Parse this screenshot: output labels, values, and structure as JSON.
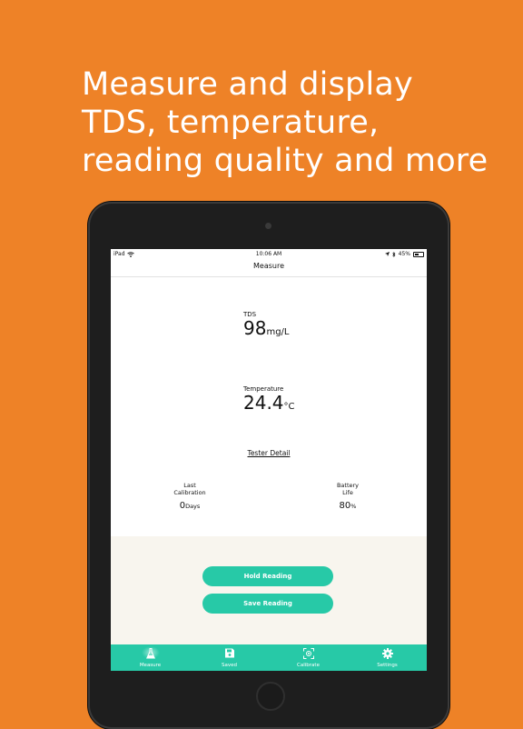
{
  "headline": {
    "lines": [
      "Measure and display",
      "TDS, temperature,",
      "reading quality and more"
    ]
  },
  "status_bar": {
    "device": "iPad",
    "time": "10:06 AM",
    "battery": "45%"
  },
  "nav": {
    "title": "Measure"
  },
  "tds": {
    "label": "TDS",
    "value": "98",
    "unit": "mg/L"
  },
  "temperature": {
    "label": "Temperature",
    "value": "24.4",
    "unit": "°C"
  },
  "tester_detail": "Tester Detail",
  "last_calibration": {
    "label_line1": "Last",
    "label_line2": "Calibration",
    "value": "0",
    "unit": "Days"
  },
  "battery_life": {
    "label_line1": "Battery",
    "label_line2": "Life",
    "value": "80",
    "unit": "%"
  },
  "buttons": {
    "hold": "Hold Reading",
    "save": "Save Reading"
  },
  "tabs": [
    {
      "label": "Measure",
      "icon": "flask-icon",
      "active": true
    },
    {
      "label": "Saved",
      "icon": "floppy-disk-icon",
      "active": false
    },
    {
      "label": "Calibrate",
      "icon": "target-icon",
      "active": false
    },
    {
      "label": "Settings",
      "icon": "gear-icon",
      "active": false
    }
  ],
  "colors": {
    "background": "#ee8227",
    "accent": "#27c9a7",
    "action_area": "#f8f5ee"
  }
}
